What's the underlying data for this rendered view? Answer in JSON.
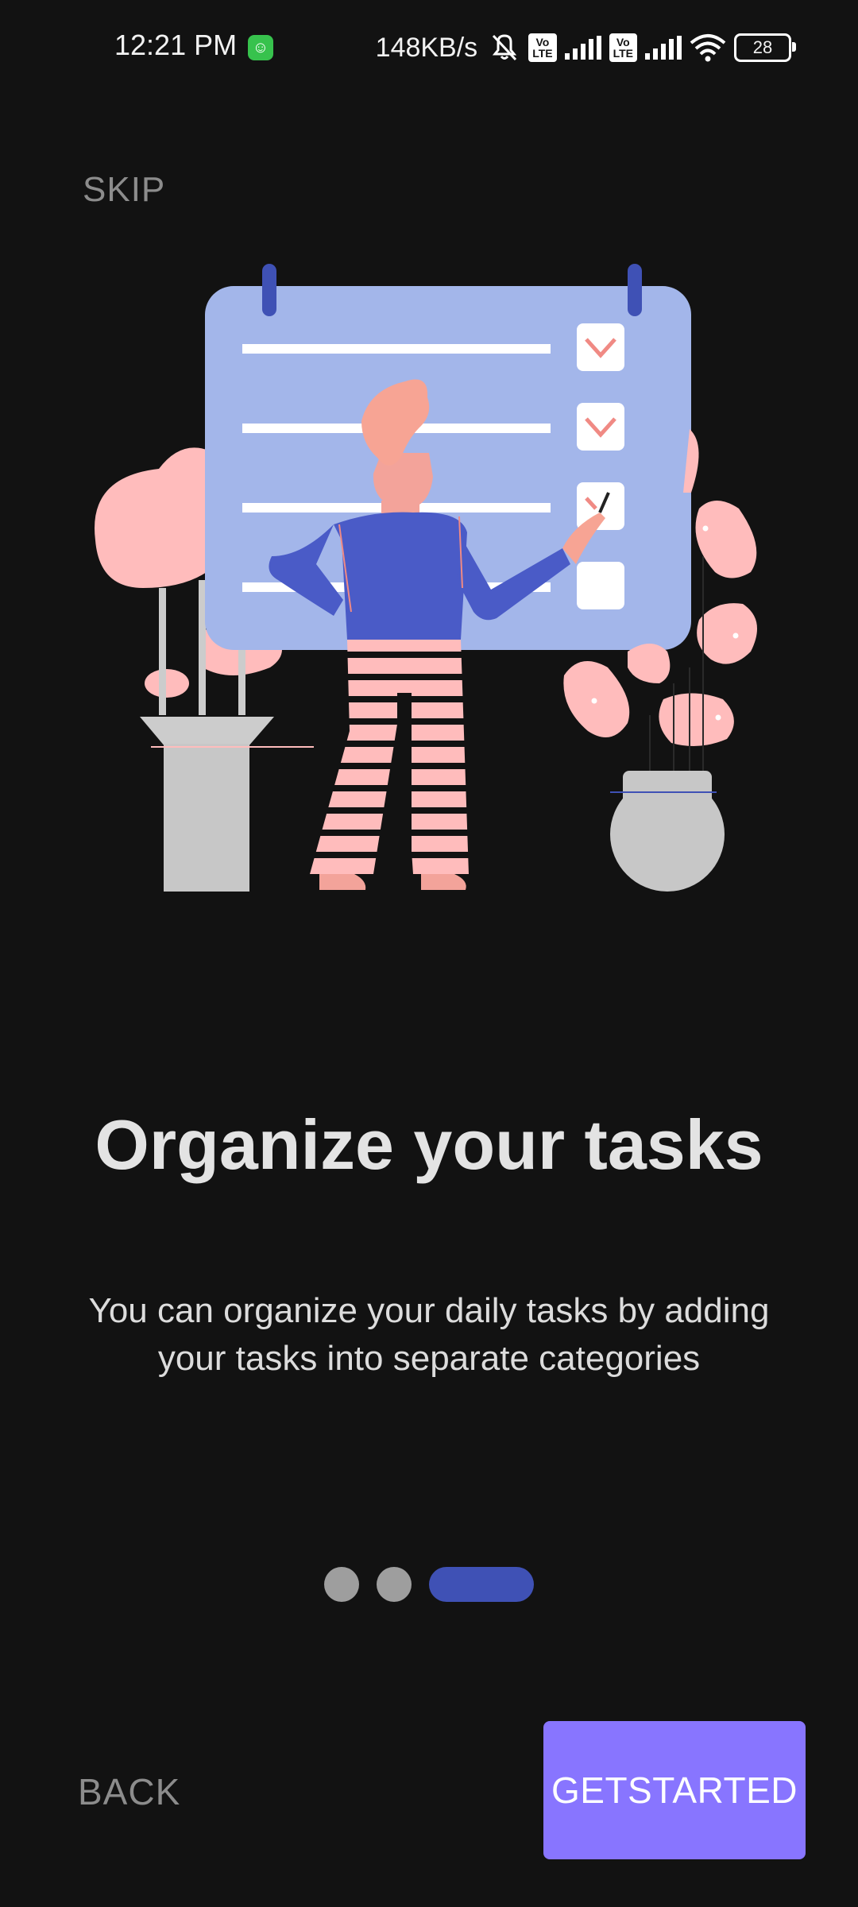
{
  "status_bar": {
    "time": "12:21 PM",
    "network_speed": "148KB/s",
    "volte_label": "Vo LTE",
    "battery_level": "28",
    "icons": [
      "android-app-icon",
      "mute-icon",
      "volte-icon",
      "signal-icon",
      "volte-icon",
      "signal-icon",
      "wifi-icon",
      "battery-icon"
    ]
  },
  "onboarding": {
    "skip_label": "SKIP",
    "title": "Organize your tasks",
    "description": "You can organize your daily tasks by adding your tasks into separate categories",
    "page_indicator": {
      "total": 3,
      "active_index": 2
    },
    "back_label": "BACK",
    "get_started_label": "GETSTARTED"
  },
  "colors": {
    "background": "#121212",
    "accent": "#8875ff",
    "indicator_active": "#3f51b5",
    "indicator_inactive": "#9e9e9e",
    "board": "#a3b6ea",
    "person_shirt": "#4a5bc7",
    "plant_pink": "#ffbcbc"
  }
}
